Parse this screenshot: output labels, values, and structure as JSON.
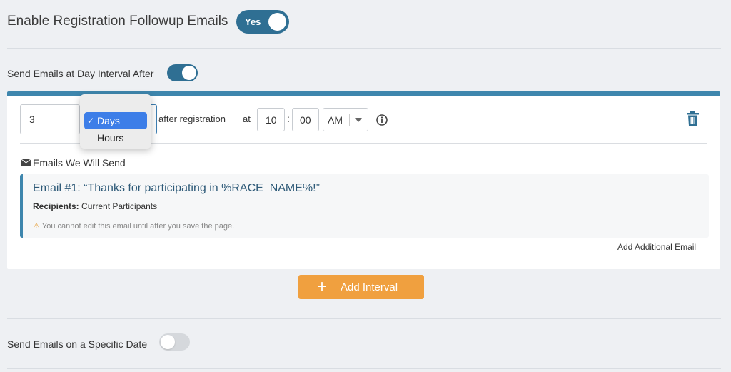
{
  "header": {
    "title": "Enable Registration Followup Emails",
    "toggle_label": "Yes"
  },
  "interval_section": {
    "label": "Send Emails at Day Interval After"
  },
  "interval_row": {
    "count_value": "3",
    "unit_options": [
      "Days",
      "Hours"
    ],
    "unit_selected": "Days",
    "after_text": "after registration",
    "at_text": "at",
    "hour": "10",
    "minute": "00",
    "time_sep": ":",
    "ampm": "AM"
  },
  "emails": {
    "heading": "Emails We Will Send",
    "items": [
      {
        "title": "Email #1: “Thanks for participating in %RACE_NAME%!”",
        "recipients_label": "Recipients:",
        "recipients_value": "Current Participants",
        "warning": "You cannot edit this email until after you save the page."
      }
    ],
    "add_email_label": "Add Additional Email"
  },
  "add_interval_label": "Add Interval",
  "specific_date_section": {
    "label": "Send Emails on a Specific Date"
  },
  "colors": {
    "accent": "#2f6f93",
    "card_border": "#3e86ad",
    "button_orange": "#f0a03f",
    "selected_blue": "#3d7ee8"
  }
}
